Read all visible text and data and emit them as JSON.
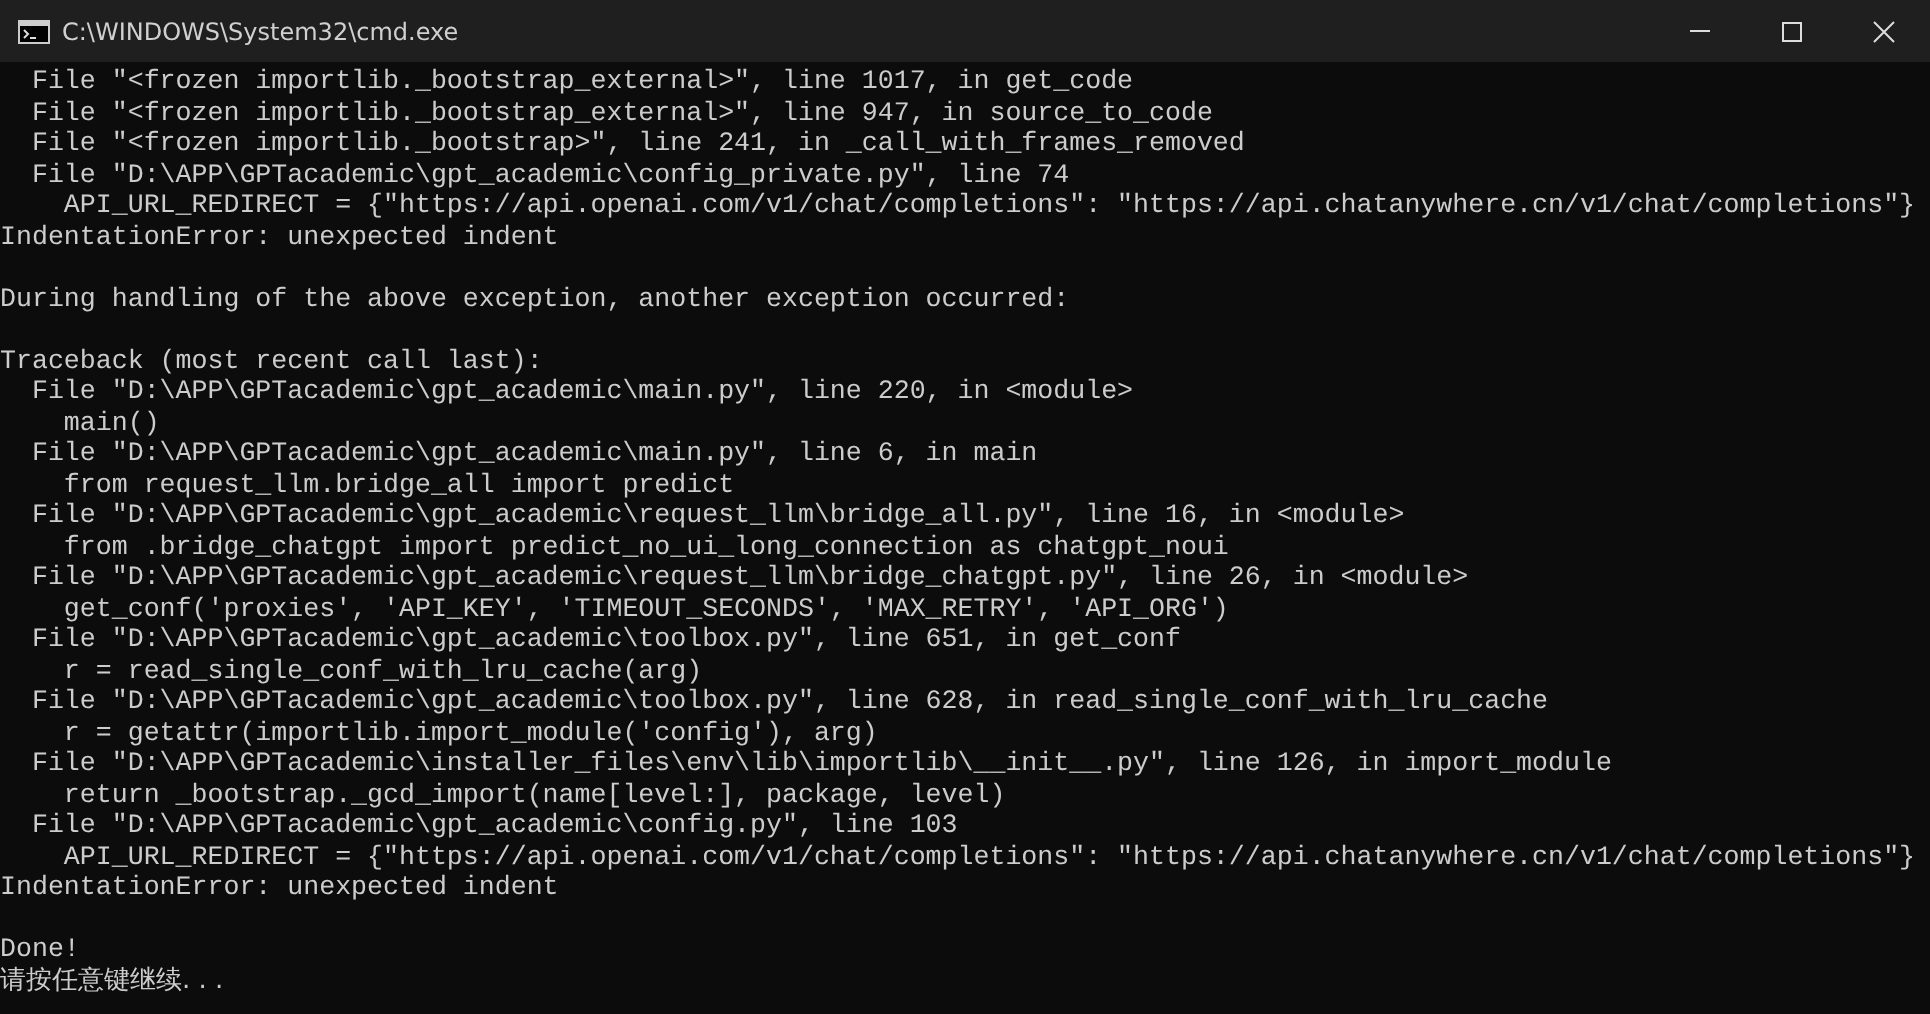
{
  "window": {
    "title": "C:\\WINDOWS\\System32\\cmd.exe"
  },
  "console": {
    "blocks": [
      [
        "  File \"<frozen importlib._bootstrap_external>\", line 1017, in get_code",
        "  File \"<frozen importlib._bootstrap_external>\", line 947, in source_to_code",
        "  File \"<frozen importlib._bootstrap>\", line 241, in _call_with_frames_removed",
        "  File \"D:\\APP\\GPTacademic\\gpt_academic\\config_private.py\", line 74",
        "    API_URL_REDIRECT = {\"https://api.openai.com/v1/chat/completions\": \"https://api.chatanywhere.cn/v1/chat/completions\"}",
        "IndentationError: unexpected indent"
      ],
      [
        "During handling of the above exception, another exception occurred:"
      ],
      [
        "Traceback (most recent call last):",
        "  File \"D:\\APP\\GPTacademic\\gpt_academic\\main.py\", line 220, in <module>",
        "    main()",
        "  File \"D:\\APP\\GPTacademic\\gpt_academic\\main.py\", line 6, in main",
        "    from request_llm.bridge_all import predict",
        "  File \"D:\\APP\\GPTacademic\\gpt_academic\\request_llm\\bridge_all.py\", line 16, in <module>",
        "    from .bridge_chatgpt import predict_no_ui_long_connection as chatgpt_noui",
        "  File \"D:\\APP\\GPTacademic\\gpt_academic\\request_llm\\bridge_chatgpt.py\", line 26, in <module>",
        "    get_conf('proxies', 'API_KEY', 'TIMEOUT_SECONDS', 'MAX_RETRY', 'API_ORG')",
        "  File \"D:\\APP\\GPTacademic\\gpt_academic\\toolbox.py\", line 651, in get_conf",
        "    r = read_single_conf_with_lru_cache(arg)",
        "  File \"D:\\APP\\GPTacademic\\gpt_academic\\toolbox.py\", line 628, in read_single_conf_with_lru_cache",
        "    r = getattr(importlib.import_module('config'), arg)",
        "  File \"D:\\APP\\GPTacademic\\installer_files\\env\\lib\\importlib\\__init__.py\", line 126, in import_module",
        "    return _bootstrap._gcd_import(name[level:], package, level)",
        "  File \"D:\\APP\\GPTacademic\\gpt_academic\\config.py\", line 103",
        "    API_URL_REDIRECT = {\"https://api.openai.com/v1/chat/completions\": \"https://api.chatanywhere.cn/v1/chat/completions\"}",
        "IndentationError: unexpected indent"
      ],
      [
        "Done!",
        "请按任意键继续. . ."
      ]
    ]
  }
}
